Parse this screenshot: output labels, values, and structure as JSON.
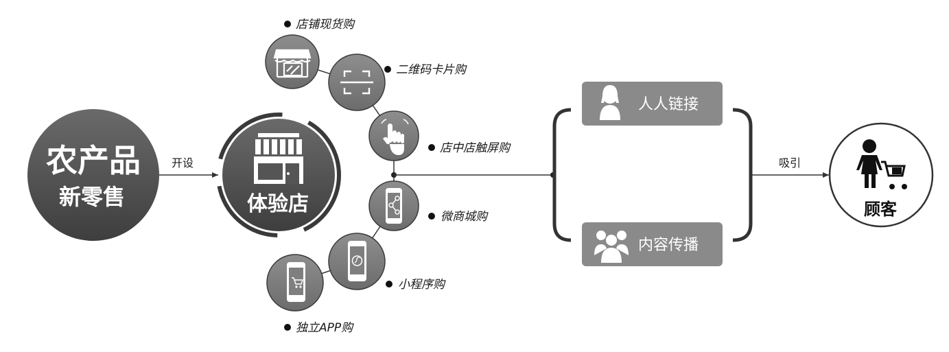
{
  "source": {
    "line1": "农产品",
    "line2": "新零售"
  },
  "open_label": "开设",
  "store": {
    "label": "体验店"
  },
  "channels": [
    {
      "label": "店铺现货购",
      "icon": "storefront-icon"
    },
    {
      "label": "二维码卡片购",
      "icon": "qr-scan-icon"
    },
    {
      "label": "店中店触屏购",
      "icon": "touch-hand-icon"
    },
    {
      "label": "微商城购",
      "icon": "share-phone-icon"
    },
    {
      "label": "小程序购",
      "icon": "mini-program-phone-icon"
    },
    {
      "label": "独立APP购",
      "icon": "cart-phone-icon"
    }
  ],
  "methods": [
    {
      "label": "人人链接",
      "icon": "person-icon"
    },
    {
      "label": "内容传播",
      "icon": "group-icon"
    }
  ],
  "attract_label": "吸引",
  "customer": {
    "label": "顾客",
    "icon": "shopper-cart-icon"
  },
  "colors": {
    "dark_circle": "#555555",
    "channel_circle": "#7f7f7f",
    "box": "#8a8a8a",
    "line": "#333333"
  }
}
